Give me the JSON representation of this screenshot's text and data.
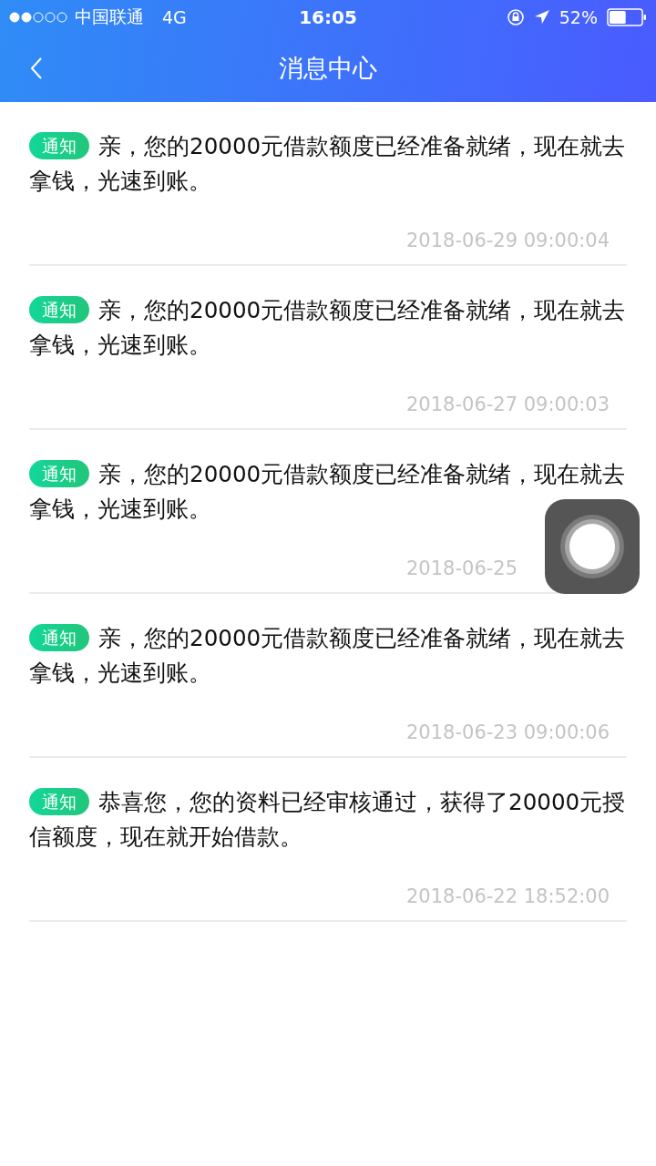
{
  "status_bar": {
    "carrier": "中国联通",
    "network": "4G",
    "time": "16:05",
    "battery": "52%"
  },
  "nav": {
    "title": "消息中心"
  },
  "messages": [
    {
      "badge": "通知",
      "text": "亲，您的20000元借款额度已经准备就绪，现在就去拿钱，光速到账。",
      "time": "2018-06-29 09:00:04"
    },
    {
      "badge": "通知",
      "text": "亲，您的20000元借款额度已经准备就绪，现在就去拿钱，光速到账。",
      "time": "2018-06-27 09:00:03"
    },
    {
      "badge": "通知",
      "text": "亲，您的20000元借款额度已经准备就绪，现在就去拿钱，光速到账。",
      "time": "2018-06-25"
    },
    {
      "badge": "通知",
      "text": "亲，您的20000元借款额度已经准备就绪，现在就去拿钱，光速到账。",
      "time": "2018-06-23 09:00:06"
    },
    {
      "badge": "通知",
      "text": "恭喜您，您的资料已经审核通过，获得了20000元授信额度，现在就开始借款。",
      "time": "2018-06-22 18:52:00"
    }
  ]
}
